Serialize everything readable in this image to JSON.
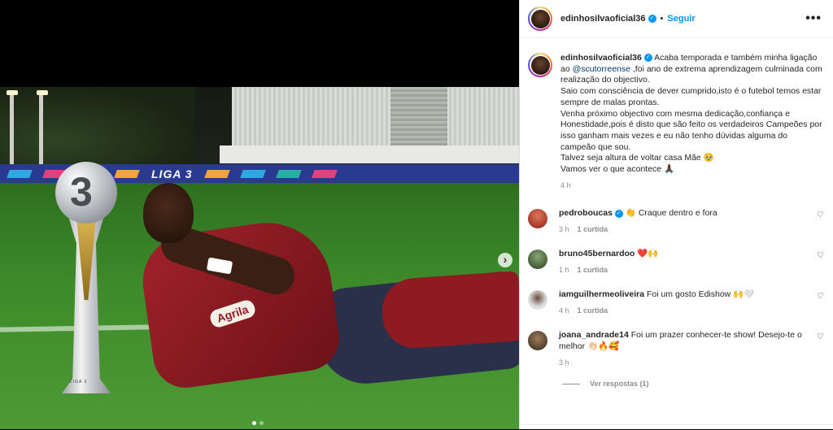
{
  "post": {
    "username": "edinhosilvaoficial36",
    "follow_label": "Seguir",
    "separator": "•",
    "more_label": "•••"
  },
  "media": {
    "ad_text": "LIGA 3",
    "trophy_number": "3",
    "trophy_label": "LIGA 3",
    "sponsor_text": "Agrila",
    "next_label": "›"
  },
  "caption": {
    "username": "edinhosilvaoficial36",
    "text_before_mention": "Acaba temporada e também minha ligação ao",
    "mention": "@scutorreense",
    "text_after_mention": ",foi ano de extrema aprendizagem culminada com realização do objectivo.",
    "line2": "Saio com consciência de dever cumprido,isto é o futebol temos estar sempre de malas prontas.",
    "line3": "Venha próximo objectivo com mesma dedicação,confiança e Honestidade,pois é disto que são feito os verdadeiros Campeões por isso ganham mais vezes e eu não tenho dúvidas alguma do campeão que sou.",
    "line4": "Talvez seja altura de voltar casa Mãe 🥹",
    "line5": "Vamos ver o que acontece 🙏🏿",
    "time": "4 h"
  },
  "comments": [
    {
      "username": "pedroboucas",
      "verified": true,
      "text": "👏 Craque dentro e fora",
      "time": "3 h",
      "likes": "1 curtida",
      "avatar_color": "#b3412f"
    },
    {
      "username": "bruno45bernardoo",
      "verified": false,
      "text": "❤️🙌",
      "time": "1 h",
      "likes": "1 curtida",
      "avatar_color": "#4f6a3f"
    },
    {
      "username": "iamguilhermeoliveira",
      "verified": false,
      "text": "Foi um gosto Edishow 🙌🤍",
      "time": "4 h",
      "likes": "1 curtida",
      "avatar_color": "#d9d9d9"
    },
    {
      "username": "joana_andrade14",
      "verified": false,
      "text": "Foi um prazer conhecer-te show! Desejo-te o melhor 👏🏻🔥🥰",
      "time": "3 h",
      "likes": "",
      "avatar_color": "#5c4a36"
    }
  ],
  "replies_label": "Ver respostas (1)",
  "colors": {
    "accent": "#0095f6",
    "verified": "#0095f6",
    "mention": "#00376b",
    "muted": "#8e8e8e"
  },
  "icons": {
    "verified": "verified-badge-icon",
    "more": "more-options-icon",
    "heart": "heart-icon",
    "next": "chevron-right-icon"
  }
}
